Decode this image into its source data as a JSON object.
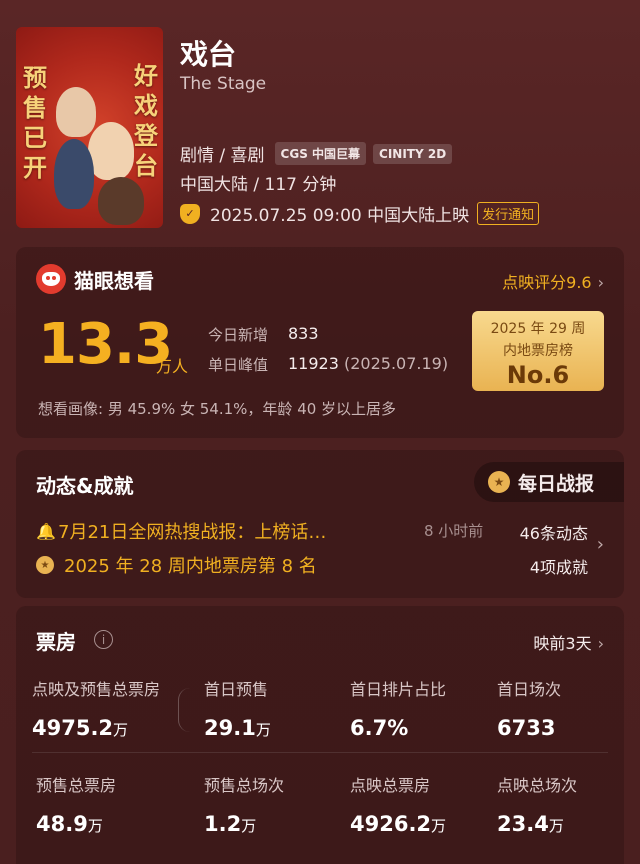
{
  "movie": {
    "title": "戏台",
    "subtitle": "The Stage",
    "genre": "剧情 / 喜剧",
    "tags": [
      "CGS 中国巨幕",
      "CINITY 2D"
    ],
    "country_duration": "中国大陆 / 117 分钟",
    "release": "2025.07.25 09:00 中国大陆上映",
    "release_notice": "发行通知",
    "poster_left_text": "预售已开",
    "poster_right_text": "好戏登台"
  },
  "maoyan": {
    "title": "猫眼想看",
    "preview_score_label": "点映评分",
    "preview_score": "9.6",
    "want_count": "13.3",
    "want_unit": "万人",
    "today_new_label": "今日新增",
    "today_new_value": "833",
    "peak_label": "单日峰值",
    "peak_value": "11923",
    "peak_date": "(2025.07.19)",
    "rank_line1": "2025 年 29 周",
    "rank_line2": "内地票房榜",
    "rank_value": "No.6",
    "demographics": "想看画像: 男 45.9%  女 54.1%，年龄 40 岁以上居多"
  },
  "dynamics": {
    "title": "动态&成就",
    "daily_report": "每日战报",
    "item1_text": "7月21日全网热搜战报：上榜话…",
    "item1_time": "8 小时前",
    "item1_count": "46条动态",
    "item2_text": "2025 年 28 周内地票房第 8 名",
    "item2_count": "4项成就"
  },
  "box_office": {
    "title": "票房",
    "days_label": "映前3天",
    "row1": [
      {
        "label": "点映及预售总票房",
        "value": "4975.2",
        "unit": "万"
      },
      {
        "label": "首日预售",
        "value": "29.1",
        "unit": "万"
      },
      {
        "label": "首日排片占比",
        "value": "6.7%",
        "unit": ""
      },
      {
        "label": "首日场次",
        "value": "6733",
        "unit": ""
      }
    ],
    "row2": [
      {
        "label": "预售总票房",
        "value": "48.9",
        "unit": "万"
      },
      {
        "label": "预售总场次",
        "value": "1.2",
        "unit": "万"
      },
      {
        "label": "点映总票房",
        "value": "4926.2",
        "unit": "万"
      },
      {
        "label": "点映总场次",
        "value": "23.4",
        "unit": "万"
      }
    ]
  },
  "colors": {
    "accent": "#f0b021",
    "background": "#4c2020"
  }
}
